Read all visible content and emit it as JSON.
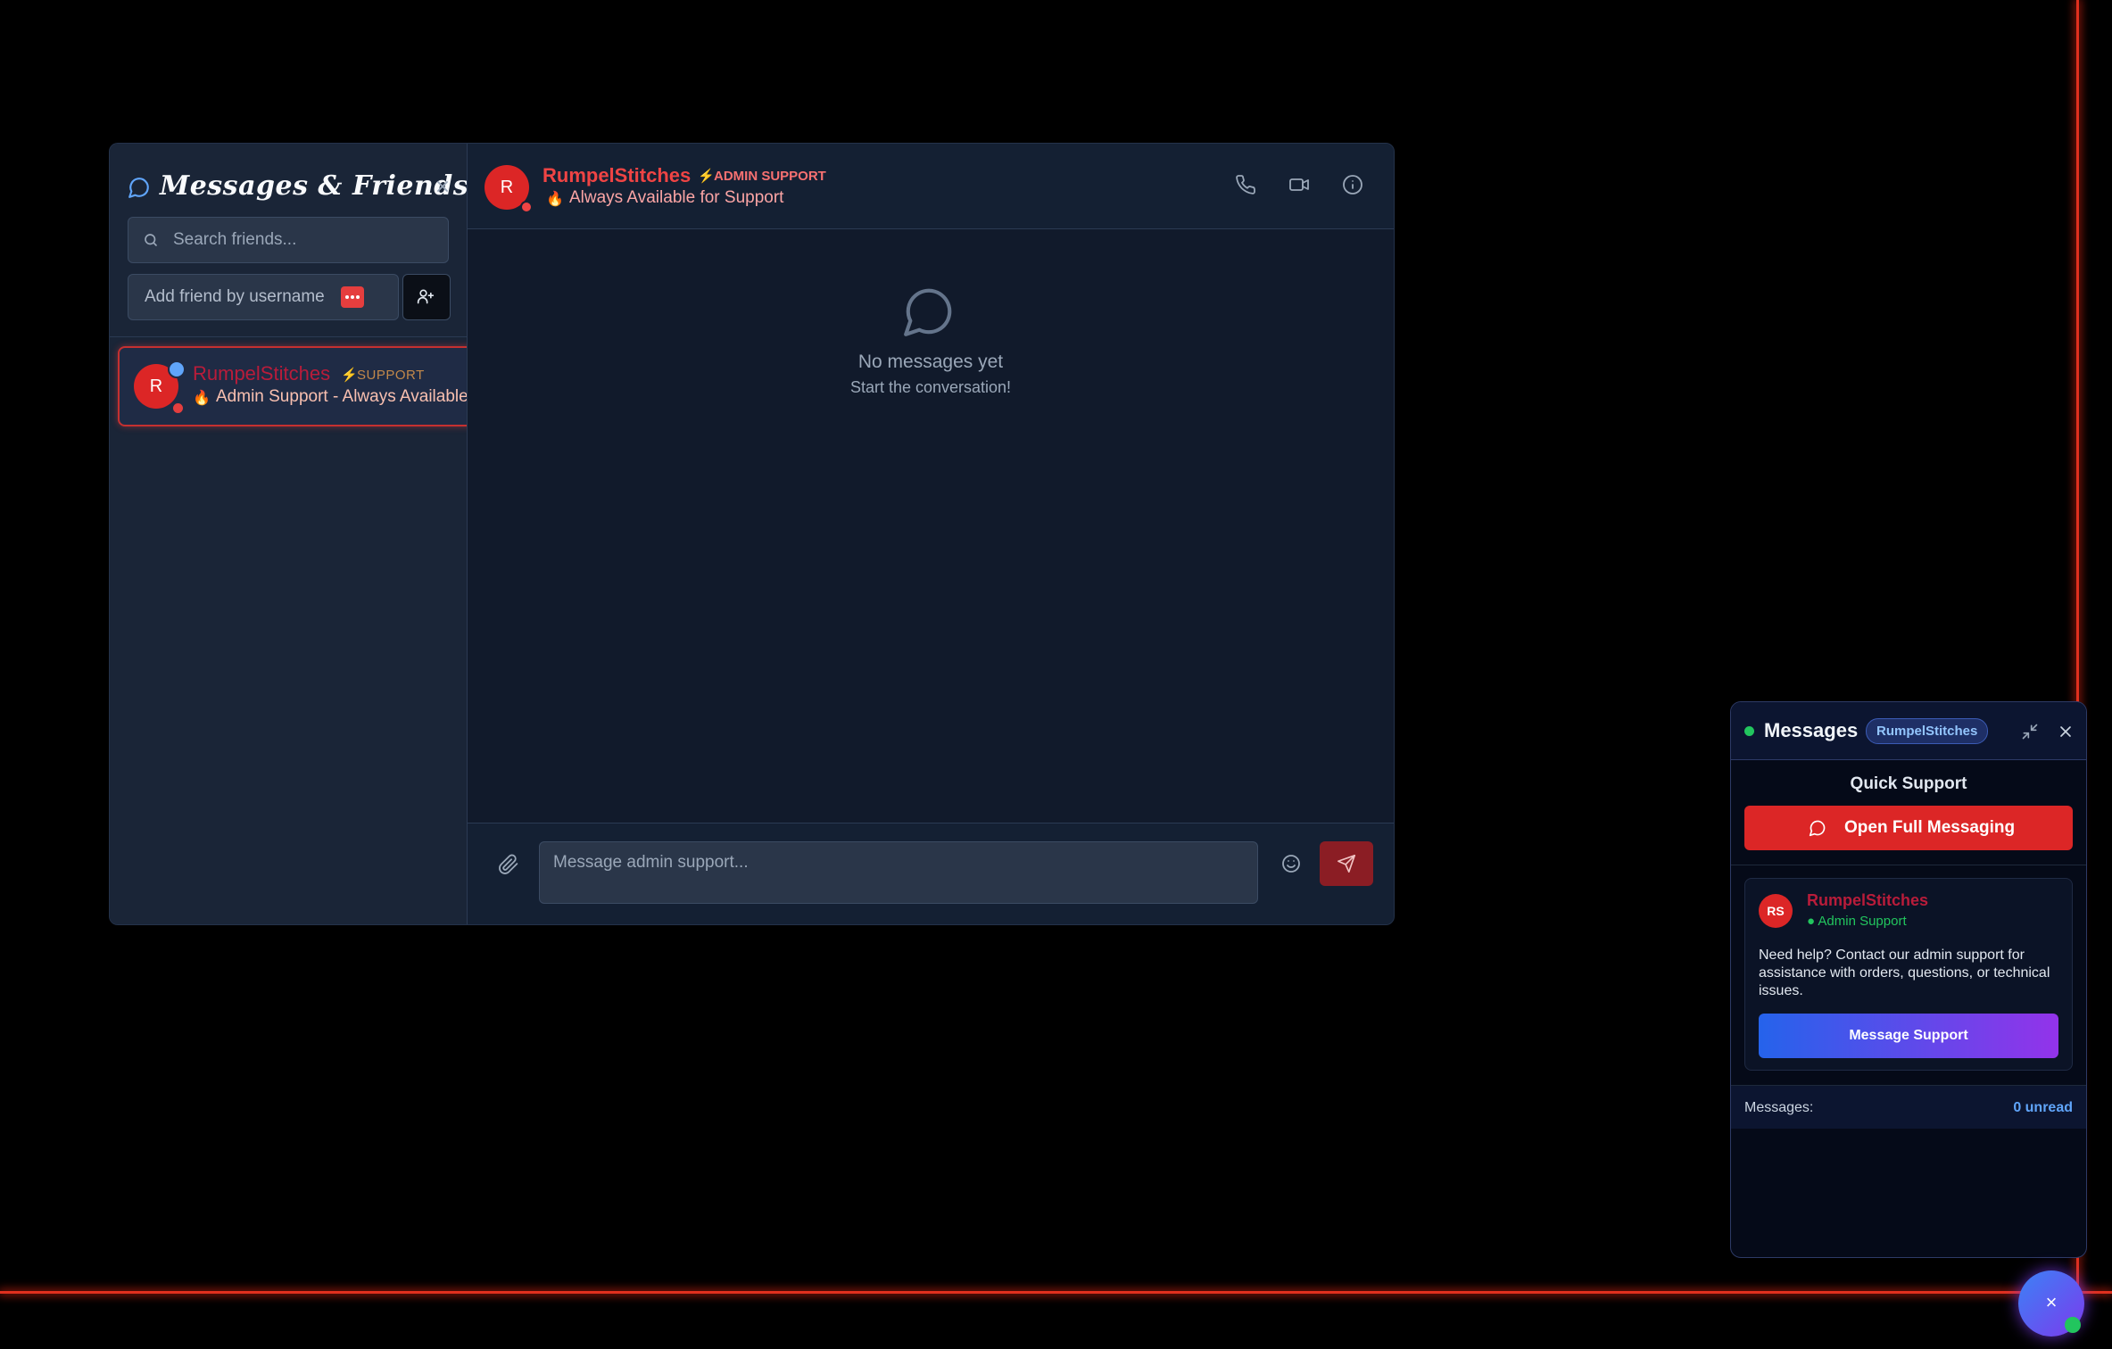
{
  "theme": {
    "accent": "#dc2626",
    "online": "#22c55e",
    "brand_gradient": [
      "#2563eb",
      "#9333ea"
    ]
  },
  "sidebar": {
    "title": "Messages & Friends",
    "search_placeholder": "Search friends...",
    "add_friend_placeholder": "Add friend by username",
    "friends": [
      {
        "avatar_letter": "R",
        "name": "RumpelStitches",
        "tag": "SUPPORT",
        "status_emoji": "🔥",
        "status_text": "Admin Support - Always Available"
      }
    ]
  },
  "chat": {
    "avatar_letter": "R",
    "name": "RumpelStitches",
    "badge": "ADMIN SUPPORT",
    "sub_emoji": "🔥",
    "subtitle": "Always Available for Support",
    "actions": [
      "phone-icon",
      "video-icon",
      "info-icon"
    ],
    "empty_title": "No messages yet",
    "empty_subtitle": "Start the conversation!",
    "input_placeholder": "Message admin support..."
  },
  "quick_panel": {
    "title": "Messages",
    "badge": "RumpelStitches",
    "section_title": "Quick Support",
    "open_button": "Open Full Messaging",
    "card": {
      "avatar_initials": "RS",
      "name": "RumpelStitches",
      "role": "● Admin Support",
      "description": "Need help? Contact our admin support for assistance with orders, questions, or technical issues.",
      "button": "Message Support"
    },
    "footer_label": "Messages:",
    "footer_value": "0 unread"
  },
  "fab": {
    "icon": "×"
  }
}
